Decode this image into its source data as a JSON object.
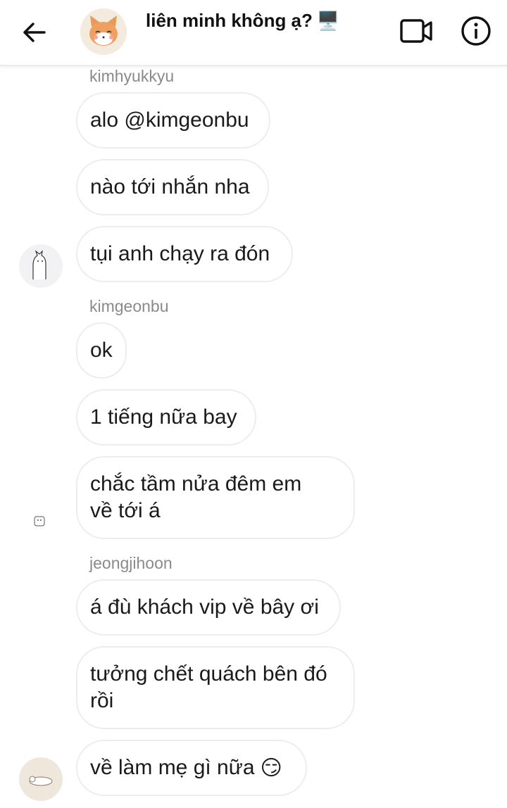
{
  "header": {
    "title": "liên minh không ạ?",
    "title_emoji": "🖥️",
    "back_icon": "arrow-left-icon",
    "video_icon": "video-camera-icon",
    "info_icon": "info-icon"
  },
  "messages": [
    {
      "sender": "kimhyukkyu",
      "text": "alo @kimgeonbu"
    },
    {
      "text": "nào tới nhắn nha"
    },
    {
      "text": "tụi anh chạy ra đón"
    },
    {
      "sender": "kimgeonbu",
      "text": "ok"
    },
    {
      "text": "1 tiếng nữa bay"
    },
    {
      "text_line1": "chắc tầm nửa đêm em",
      "text_line2": "về tới á"
    },
    {
      "sender": "jeongjihoon",
      "text": "á đù khách vip về bây ơi"
    },
    {
      "text_line1": "tưởng chết quách bên đó",
      "text_line2": "rồi"
    },
    {
      "text": "về làm mẹ gì nữa",
      "emoji": "😏"
    }
  ],
  "colors": {
    "bubble_border": "#ededed",
    "sender_name": "#8a8a8a",
    "text": "#1a1a1a"
  }
}
